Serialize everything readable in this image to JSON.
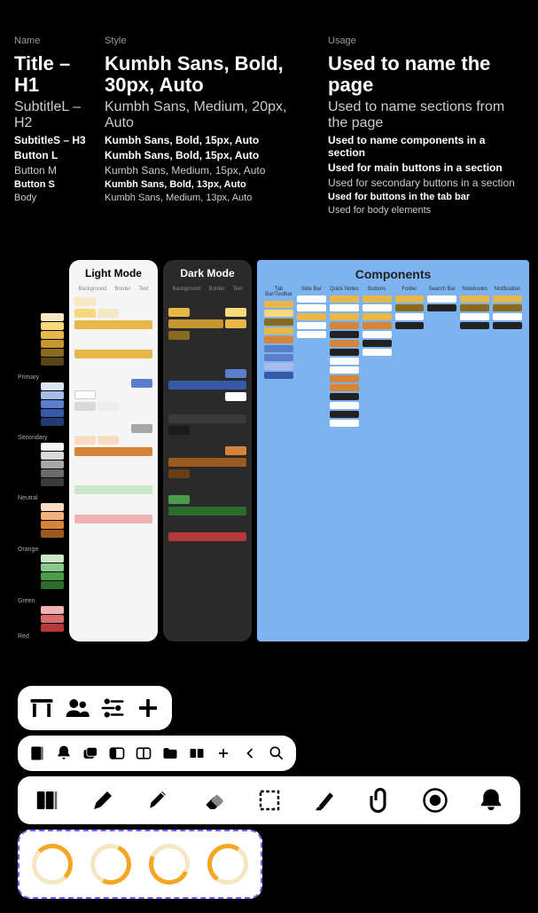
{
  "typography": {
    "columns": [
      "Name",
      "Style",
      "Usage"
    ],
    "rows": [
      {
        "name": "Title – H1",
        "style": "Kumbh Sans, Bold, 30px, Auto",
        "usage": "Used to name the page",
        "cls": "h1"
      },
      {
        "name": "SubtitleL – H2",
        "style": "Kumbh Sans, Medium, 20px, Auto",
        "usage": "Used to name sections from the page",
        "cls": "h2"
      },
      {
        "name": "SubtitleS – H3",
        "style": "Kumbh Sans, Bold, 15px, Auto",
        "usage": "Used to name components in a section",
        "cls": "h3"
      },
      {
        "name": "Button L",
        "style": "Kumbh Sans, Bold, 15px, Auto",
        "usage": "Used for main buttons in a section",
        "cls": "btnL"
      },
      {
        "name": "Button M",
        "style": "Kumbh Sans, Medium, 15px, Auto",
        "usage": "Used for secondary buttons in a section",
        "cls": "btnM"
      },
      {
        "name": "Button S",
        "style": "Kumbh Sans, Bold, 13px, Auto",
        "usage": "Used for buttons in the tab bar",
        "cls": "btnS"
      },
      {
        "name": "Body",
        "style": "Kumbh Sans, Medium, 13px, Auto",
        "usage": "Used for body elements",
        "cls": "body-t"
      }
    ]
  },
  "colorGroups": [
    "Primary",
    "Secondary",
    "Neutral",
    "Orange",
    "Green",
    "Red"
  ],
  "modePanels": {
    "light": {
      "title": "Light Mode",
      "sub": [
        "Background",
        "Border",
        "Text"
      ]
    },
    "dark": {
      "title": "Dark Mode",
      "sub": [
        "Background",
        "Border",
        "Text"
      ]
    }
  },
  "components": {
    "title": "Components",
    "cols": [
      "Tab Bar/Toolbar",
      "Side Bar",
      "Quick Notes",
      "Buttons",
      "Folder",
      "Search Bar",
      "Notebooks",
      "Notification"
    ]
  },
  "iconRows": {
    "row1": [
      "table-icon",
      "people-icon",
      "sliders-icon",
      "plus-icon"
    ],
    "row2": [
      "book-icon",
      "bell-icon",
      "windows-icon",
      "sidebar-left-icon",
      "sidebar-split-icon",
      "folder-icon",
      "cards-icon",
      "plus-small-icon",
      "chevron-left-icon",
      "search-icon"
    ],
    "row3": [
      "books-icon",
      "pencil-icon",
      "pen-icon",
      "eraser-icon",
      "select-icon",
      "marker-icon",
      "paperclip-icon",
      "record-icon",
      "bell-large-icon"
    ]
  },
  "spinners": [
    "spinner-1",
    "spinner-2",
    "spinner-3",
    "spinner-4"
  ]
}
